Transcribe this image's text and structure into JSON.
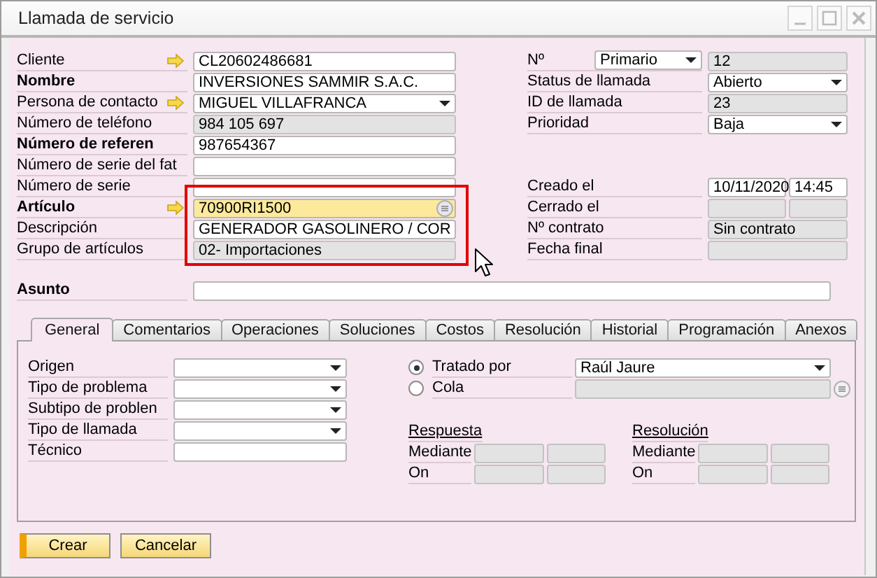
{
  "window": {
    "title": "Llamada de servicio"
  },
  "header_left": [
    {
      "label": "Cliente",
      "emphasis": false,
      "link": true,
      "inputs": [
        {
          "kind": "text",
          "value": "CL20602486681"
        }
      ]
    },
    {
      "label": "Nombre",
      "emphasis": true,
      "link": false,
      "inputs": [
        {
          "kind": "text",
          "value": "INVERSIONES SAMMIR S.A.C."
        }
      ]
    },
    {
      "label": "Persona de contacto",
      "emphasis": false,
      "link": true,
      "inputs": [
        {
          "kind": "dropdown",
          "value": "MIGUEL VILLAFRANCA"
        }
      ]
    },
    {
      "label": "Número de teléfono",
      "emphasis": false,
      "link": false,
      "inputs": [
        {
          "kind": "readonly",
          "value": "984 105 697"
        }
      ]
    },
    {
      "label": "Número de referen",
      "emphasis": true,
      "link": false,
      "inputs": [
        {
          "kind": "text",
          "value": "987654367"
        }
      ]
    },
    {
      "label": "Número de serie del fat",
      "emphasis": false,
      "link": false,
      "inputs": [
        {
          "kind": "text"
        }
      ]
    },
    {
      "label": "Número de serie",
      "emphasis": false,
      "link": false,
      "inputs": [
        {
          "kind": "text"
        }
      ]
    },
    {
      "label": "Artículo",
      "emphasis": true,
      "link": true,
      "inputs": [
        {
          "kind": "lookup",
          "value": "70900RI1500"
        }
      ]
    },
    {
      "label": "Descripción",
      "emphasis": false,
      "link": false,
      "inputs": [
        {
          "kind": "text",
          "value": "GENERADOR GASOLINERO / COR"
        }
      ]
    },
    {
      "label": "Grupo de artículos",
      "emphasis": false,
      "link": false,
      "inputs": [
        {
          "kind": "readonly",
          "value": "02- Importaciones"
        }
      ]
    }
  ],
  "header_right_top": [
    {
      "label": "Nº",
      "emphasis": false,
      "link": false,
      "selector": {
        "kind": "dropdown",
        "value": "Primario"
      },
      "inputs": [
        {
          "kind": "readonly",
          "value": "12"
        }
      ]
    },
    {
      "label": "Status de llamada",
      "emphasis": false,
      "link": false,
      "inputs": [
        {
          "kind": "dropdown",
          "value": "Abierto"
        }
      ]
    },
    {
      "label": "ID de llamada",
      "emphasis": false,
      "link": false,
      "inputs": [
        {
          "kind": "readonly",
          "value": "23"
        }
      ]
    },
    {
      "label": "Prioridad",
      "emphasis": false,
      "link": false,
      "inputs": [
        {
          "kind": "dropdown",
          "value": "Baja"
        }
      ]
    }
  ],
  "header_right_bottom": [
    {
      "label": "Creado el",
      "emphasis": false,
      "link": false,
      "inputs": [
        {
          "kind": "text",
          "value": "10/11/2020"
        },
        {
          "kind": "text",
          "value": "14:45"
        }
      ]
    },
    {
      "label": "Cerrado el",
      "emphasis": false,
      "link": false,
      "inputs": [
        {
          "kind": "readonly"
        },
        {
          "kind": "readonly"
        }
      ]
    },
    {
      "label": "Nº contrato",
      "emphasis": false,
      "link": false,
      "inputs": [
        {
          "kind": "readonly",
          "value": "Sin contrato"
        }
      ]
    },
    {
      "label": "Fecha final",
      "emphasis": false,
      "link": false,
      "inputs": [
        {
          "kind": "readonly"
        }
      ]
    }
  ],
  "subject": {
    "label": "Asunto",
    "emphasis": true,
    "link": false,
    "inputs": [
      {
        "kind": "text"
      }
    ]
  },
  "tabs": [
    {
      "label": "General",
      "selected": true
    },
    {
      "label": "Comentarios",
      "selected": false
    },
    {
      "label": "Operaciones",
      "selected": false
    },
    {
      "label": "Soluciones",
      "selected": false
    },
    {
      "label": "Costos",
      "selected": false
    },
    {
      "label": "Resolución",
      "selected": false
    },
    {
      "label": "Historial",
      "selected": false
    },
    {
      "label": "Programación",
      "selected": false
    },
    {
      "label": "Anexos",
      "selected": false
    }
  ],
  "general": {
    "fields": [
      {
        "label": "Origen",
        "emphasis": false,
        "link": false,
        "inputs": [
          {
            "kind": "dropdown"
          }
        ]
      },
      {
        "label": "Tipo de problema",
        "emphasis": false,
        "link": false,
        "inputs": [
          {
            "kind": "dropdown"
          }
        ]
      },
      {
        "label": "Subtipo de problen",
        "emphasis": false,
        "link": false,
        "inputs": [
          {
            "kind": "dropdown"
          }
        ]
      },
      {
        "label": "Tipo de llamada",
        "emphasis": false,
        "link": false,
        "inputs": [
          {
            "kind": "dropdown"
          }
        ]
      },
      {
        "label": "Técnico",
        "emphasis": false,
        "link": false,
        "inputs": [
          {
            "kind": "text"
          }
        ]
      }
    ],
    "assignment": [
      {
        "label": "Tratado por",
        "selected": true,
        "list_button": false,
        "inputs": [
          {
            "kind": "dropdown",
            "value": "Raúl Jaure"
          }
        ]
      },
      {
        "label": "Cola",
        "selected": false,
        "list_button": true,
        "inputs": [
          {
            "kind": "readonly"
          }
        ]
      }
    ],
    "sections": [
      {
        "title": "Respuesta",
        "rows": [
          {
            "label": "Mediante",
            "inputs": [
              {
                "kind": "readonly"
              },
              {
                "kind": "readonly"
              }
            ]
          },
          {
            "label": "On",
            "inputs": [
              {
                "kind": "readonly"
              },
              {
                "kind": "readonly"
              }
            ]
          }
        ]
      },
      {
        "title": "Resolución",
        "rows": [
          {
            "label": "Mediante",
            "inputs": [
              {
                "kind": "readonly"
              },
              {
                "kind": "readonly"
              }
            ]
          },
          {
            "label": "On",
            "inputs": [
              {
                "kind": "readonly"
              },
              {
                "kind": "readonly"
              }
            ]
          }
        ]
      }
    ]
  },
  "buttons": [
    {
      "label": "Crear",
      "primary": true
    },
    {
      "label": "Cancelar",
      "primary": false
    }
  ]
}
